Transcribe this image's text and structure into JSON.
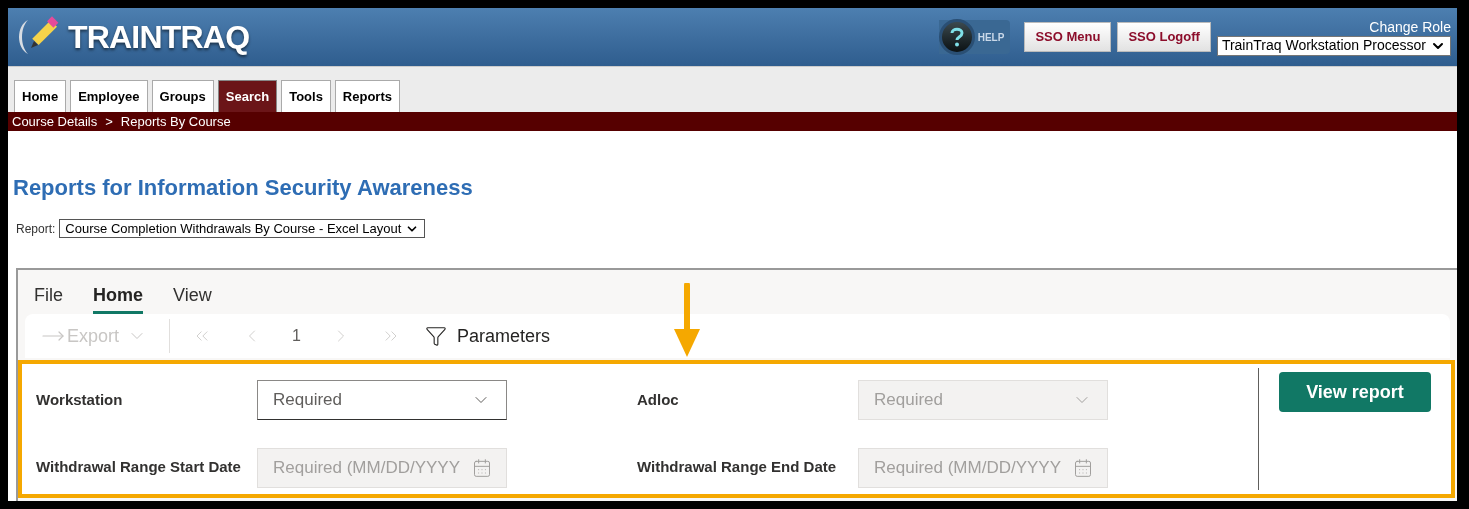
{
  "header": {
    "logo": "TRAINTRAQ",
    "help_label": "HELP",
    "buttons": [
      "SSO Menu",
      "SSO Logoff"
    ],
    "role_label": "Change Role",
    "role_value": "TrainTraq Workstation Processor"
  },
  "tabs": [
    {
      "label": "Home",
      "selected": false
    },
    {
      "label": "Employee",
      "selected": false
    },
    {
      "label": "Groups",
      "selected": false
    },
    {
      "label": "Search",
      "selected": true
    },
    {
      "label": "Tools",
      "selected": false
    },
    {
      "label": "Reports",
      "selected": false
    }
  ],
  "breadcrumb": [
    "Course Details",
    "Reports By Course"
  ],
  "breadcrumb_separator": ">",
  "page_title": "Reports for Information Security Awareness",
  "report_select": {
    "label": "Report:",
    "value": "Course Completion Withdrawals By Course - Excel Layout"
  },
  "viewer": {
    "menu_tabs": [
      {
        "label": "File",
        "selected": false
      },
      {
        "label": "Home",
        "selected": true
      },
      {
        "label": "View",
        "selected": false
      }
    ],
    "toolbar": {
      "export": {
        "label": "Export",
        "disabled": true
      },
      "nav_disabled": true,
      "page": "1",
      "parameters": "Parameters"
    },
    "parameters": [
      {
        "label": "Workstation",
        "kind": "select",
        "placeholder": "Required",
        "disabled": false
      },
      {
        "label": "Adloc",
        "kind": "select",
        "placeholder": "Required",
        "disabled": true
      },
      {
        "label": "Withdrawal Range Start Date",
        "kind": "date",
        "placeholder": "Required (MM/DD/YYYY",
        "disabled": true
      },
      {
        "label": "Withdrawal Range End Date",
        "kind": "date",
        "placeholder": "Required (MM/DD/YYYY",
        "disabled": true
      }
    ],
    "view_button": "View report"
  }
}
